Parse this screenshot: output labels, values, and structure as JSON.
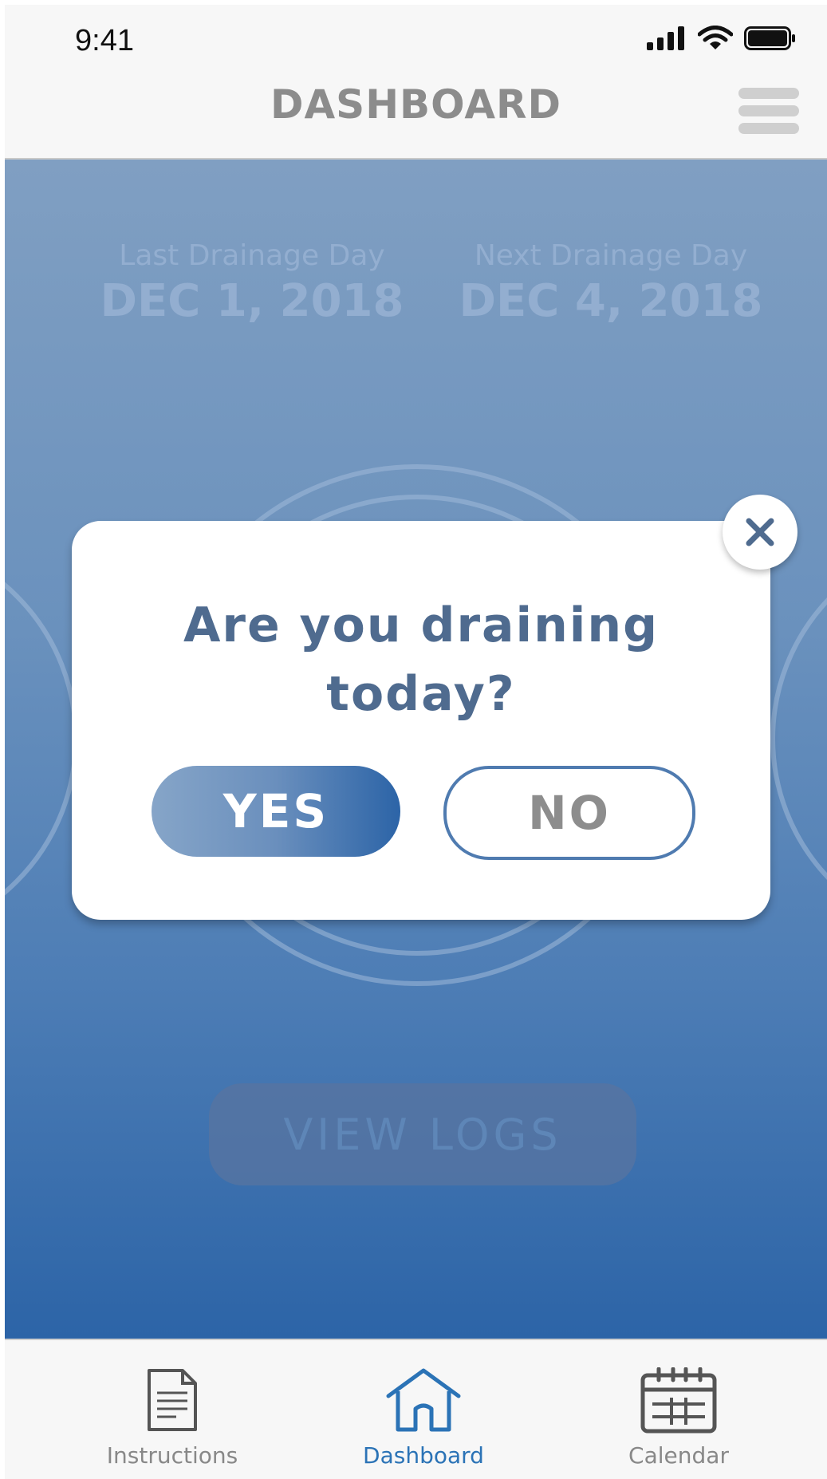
{
  "status_bar": {
    "time": "9:41"
  },
  "header": {
    "title": "DASHBOARD"
  },
  "dates": {
    "last_label": "Last Drainage Day",
    "last_value": "DEC 1, 2018",
    "next_label": "Next Drainage Day",
    "next_value": "DEC 4, 2018"
  },
  "view_logs_label": "VIEW LOGS",
  "modal": {
    "question": "Are you draining today?",
    "yes_label": "YES",
    "no_label": "NO"
  },
  "tab_bar": {
    "tabs": [
      {
        "label": "Instructions",
        "icon": "document-icon"
      },
      {
        "label": "Dashboard",
        "icon": "home-icon",
        "active": true
      },
      {
        "label": "Calendar",
        "icon": "calendar-icon"
      }
    ]
  },
  "colors": {
    "accent": "#2c64a7",
    "modal_text": "#4f6b8f",
    "active_tab": "#2b73b6"
  }
}
